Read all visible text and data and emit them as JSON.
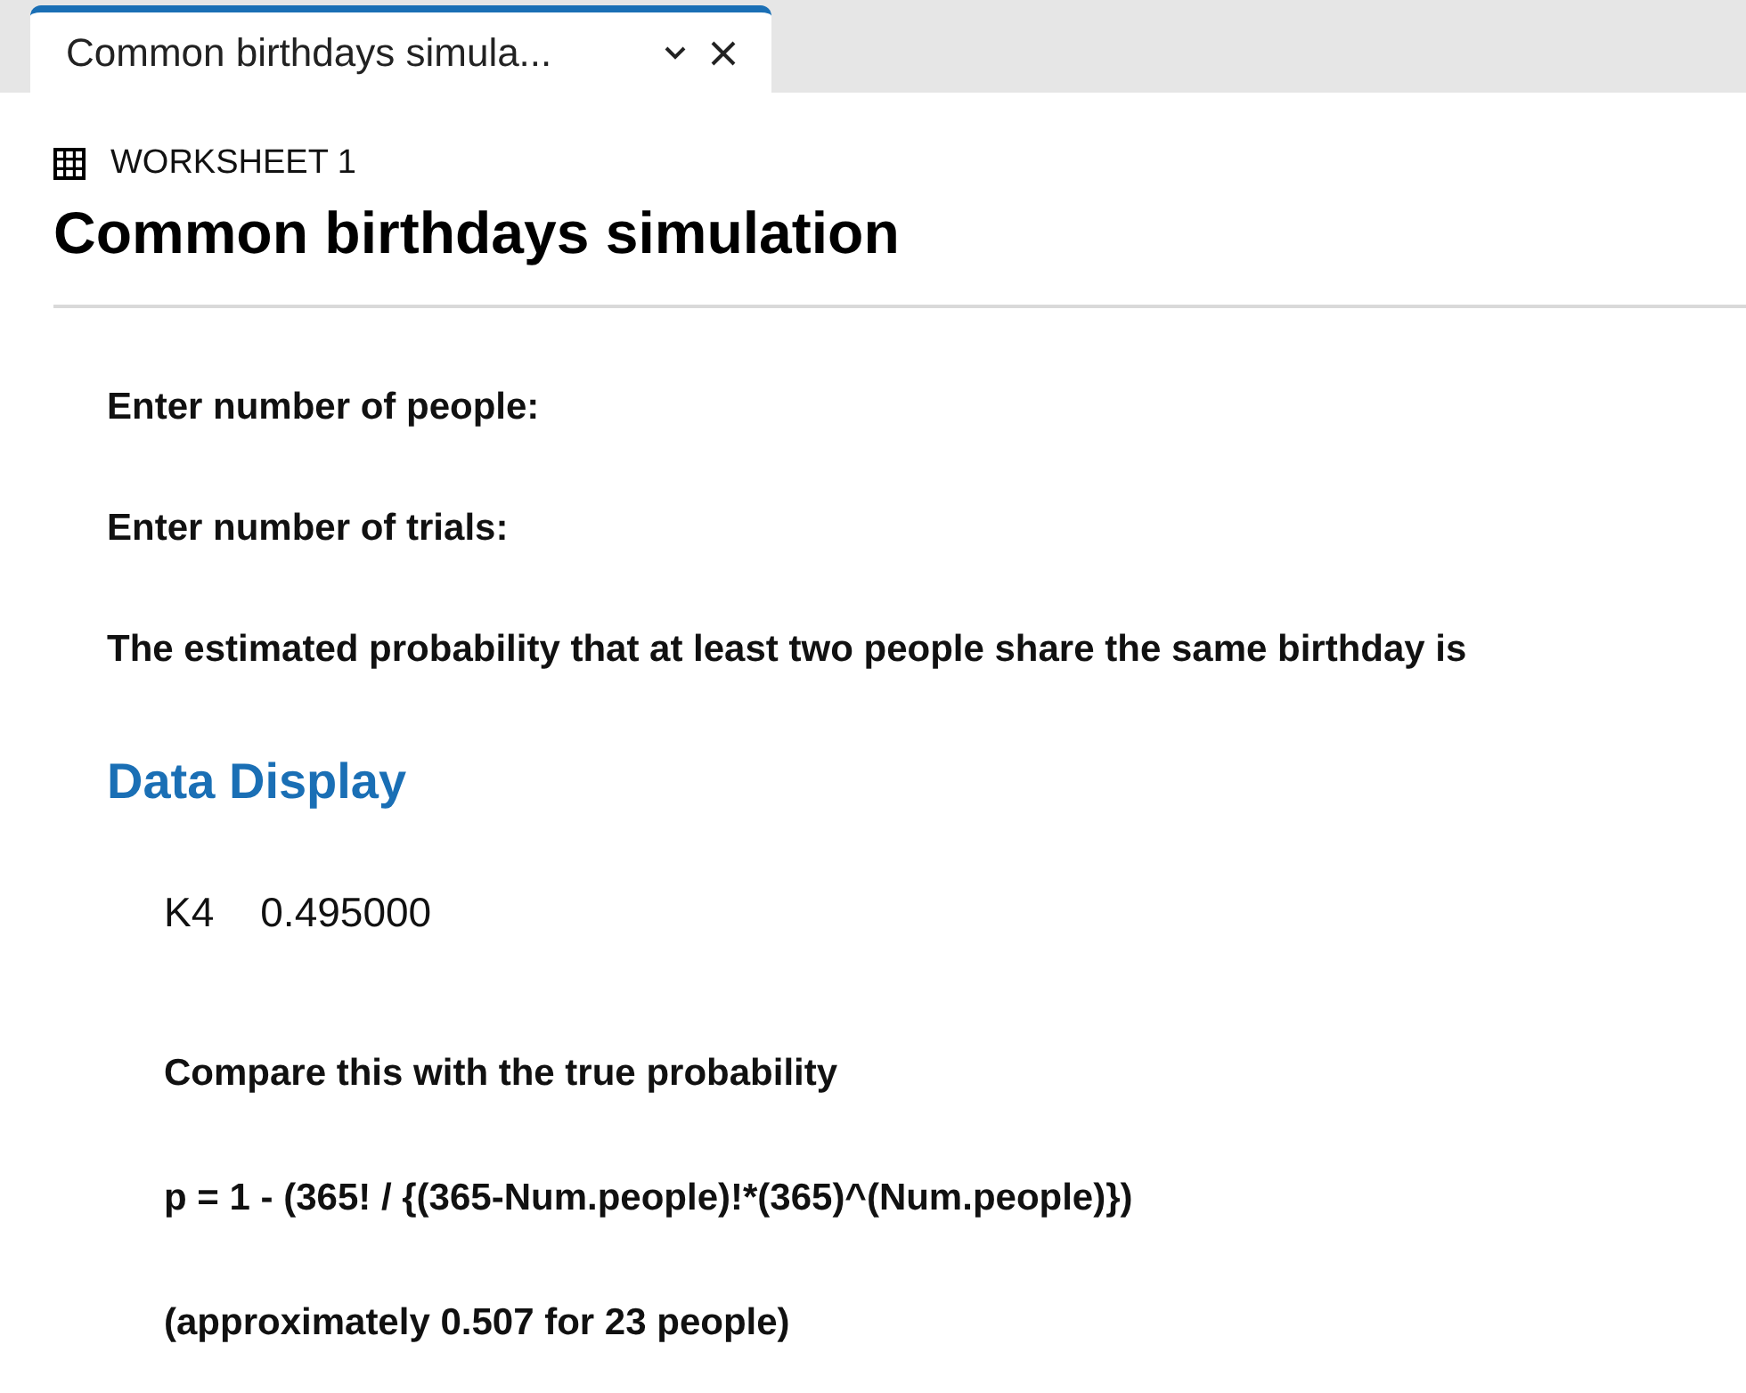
{
  "tabs": [
    {
      "label": "Common birthdays simula...",
      "selected": true
    }
  ],
  "worksheet": {
    "label": "WORKSHEET 1",
    "title": "Common birthdays simulation"
  },
  "blocks": [
    {
      "kind": "prompt",
      "text": "Enter number of people:"
    },
    {
      "kind": "prompt",
      "text": "Enter number of trials:"
    },
    {
      "kind": "prompt",
      "text": "The estimated probability that at least two people share the same birthday is"
    },
    {
      "kind": "heading",
      "text": "Data Display"
    },
    {
      "kind": "output",
      "name": "K4",
      "value": "0.495000"
    },
    {
      "kind": "note",
      "text": "Compare this with the true probability"
    },
    {
      "kind": "note",
      "text": "p = 1 - (365! / {(365-Num.people)!*(365)^(Num.people)})"
    },
    {
      "kind": "note",
      "text": "(approximately 0.507 for 23 people)"
    }
  ]
}
